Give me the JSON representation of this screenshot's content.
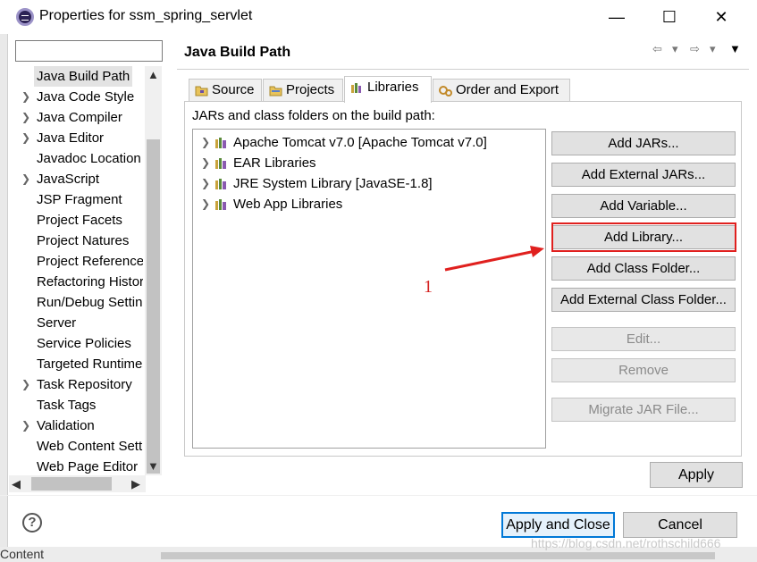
{
  "window": {
    "title": "Properties for ssm_spring_servlet",
    "minimize": "—",
    "maximize": "☐",
    "close": "✕"
  },
  "left_panel": {
    "filter_placeholder": "",
    "items": [
      {
        "label": "Java Build Path",
        "expandable": false,
        "selected": true
      },
      {
        "label": "Java Code Style",
        "expandable": true
      },
      {
        "label": "Java Compiler",
        "expandable": true
      },
      {
        "label": "Java Editor",
        "expandable": true
      },
      {
        "label": "Javadoc Location",
        "expandable": false
      },
      {
        "label": "JavaScript",
        "expandable": true
      },
      {
        "label": "JSP Fragment",
        "expandable": false
      },
      {
        "label": "Project Facets",
        "expandable": false
      },
      {
        "label": "Project Natures",
        "expandable": false
      },
      {
        "label": "Project References",
        "expandable": false
      },
      {
        "label": "Refactoring History",
        "expandable": false
      },
      {
        "label": "Run/Debug Settings",
        "expandable": false
      },
      {
        "label": "Server",
        "expandable": false
      },
      {
        "label": "Service Policies",
        "expandable": false
      },
      {
        "label": "Targeted Runtimes",
        "expandable": false
      },
      {
        "label": "Task Repository",
        "expandable": true
      },
      {
        "label": "Task Tags",
        "expandable": false
      },
      {
        "label": "Validation",
        "expandable": true
      },
      {
        "label": "Web Content Settings",
        "expandable": false
      },
      {
        "label": "Web Page Editor",
        "expandable": false
      }
    ]
  },
  "page": {
    "title": "Java Build Path",
    "tabs": [
      {
        "label": "Source",
        "active": false
      },
      {
        "label": "Projects",
        "active": false
      },
      {
        "label": "Libraries",
        "active": true
      },
      {
        "label": "Order and Export",
        "active": false
      }
    ],
    "section_label": "JARs and class folders on the build path:",
    "libraries": [
      "Apache Tomcat v7.0 [Apache Tomcat v7.0]",
      "EAR Libraries",
      "JRE System Library [JavaSE-1.8]",
      "Web App Libraries"
    ],
    "buttons": {
      "add_jars": "Add JARs...",
      "add_external_jars": "Add External JARs...",
      "add_variable": "Add Variable...",
      "add_library": "Add Library...",
      "add_class_folder": "Add Class Folder...",
      "add_external_class_folder": "Add External Class Folder...",
      "edit": "Edit...",
      "remove": "Remove",
      "migrate_jar": "Migrate JAR File..."
    },
    "apply": "Apply"
  },
  "annotation": {
    "number": "1",
    "color": "#d4201e"
  },
  "footer": {
    "help": "?",
    "apply_and_close": "Apply and Close",
    "cancel": "Cancel",
    "watermark": "https://blog.csdn.net/rothschild666"
  },
  "background_window": {
    "bottom_label": "Content"
  }
}
